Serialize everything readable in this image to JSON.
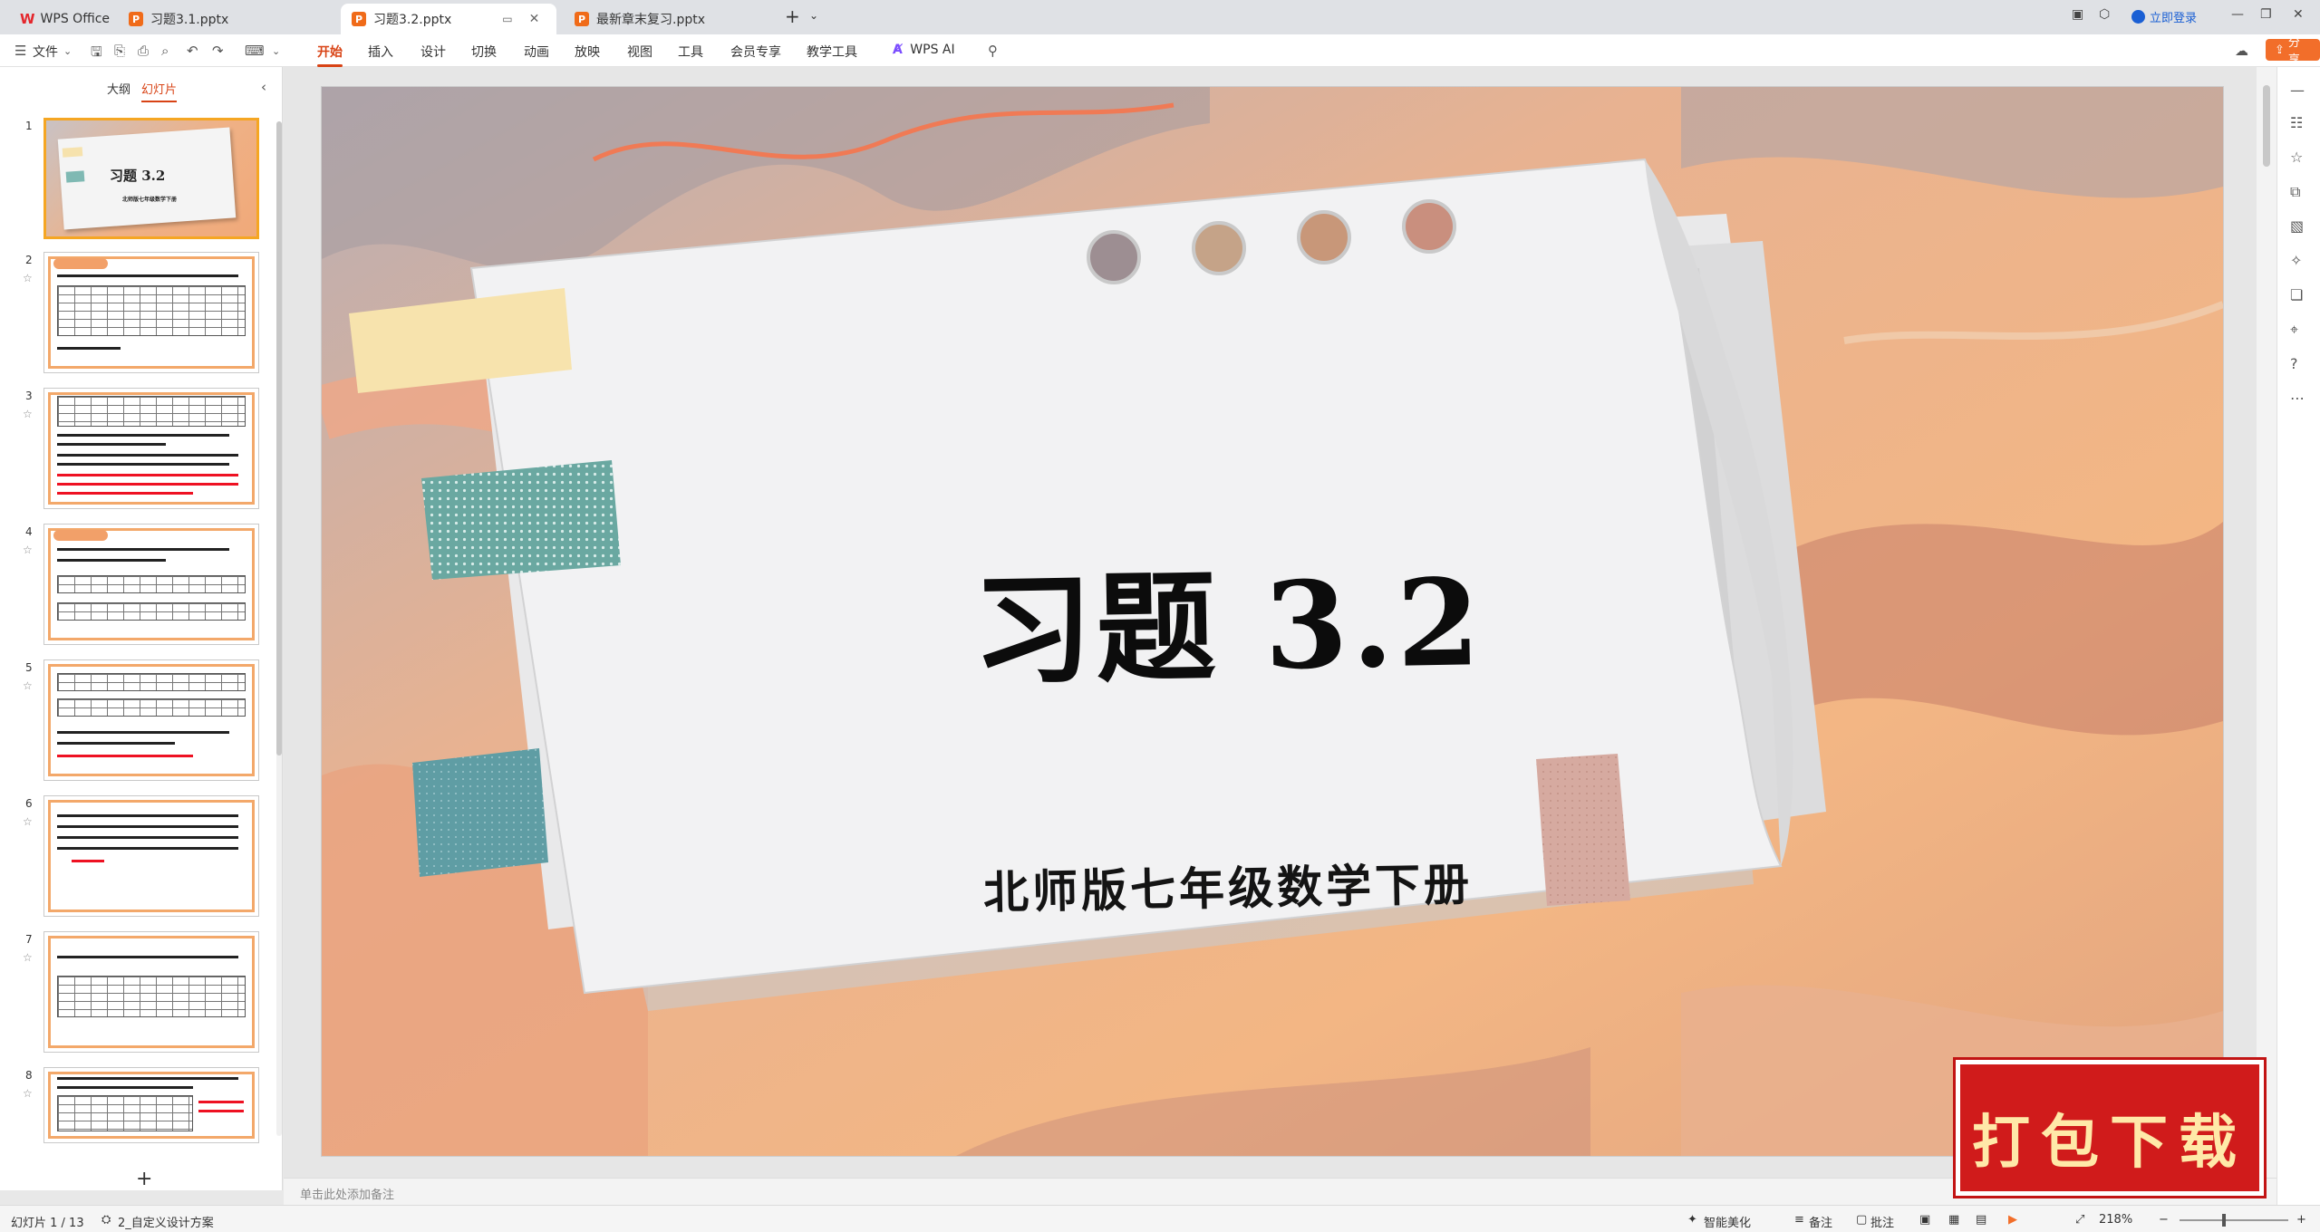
{
  "titlebar": {
    "tabs": [
      {
        "label": "WPS Office",
        "icon": "wps-logo-icon"
      },
      {
        "label": "习题3.1.pptx",
        "icon": "ppt-file-icon"
      },
      {
        "label": "习题3.2.pptx",
        "icon": "ppt-file-icon",
        "active": true
      },
      {
        "label": "最新章末复习.pptx",
        "icon": "ppt-file-icon"
      }
    ],
    "add_tab": "+",
    "login_label": "立即登录"
  },
  "ribbon": {
    "file_menu": "文件",
    "tabs": [
      "开始",
      "插入",
      "设计",
      "切换",
      "动画",
      "放映",
      "视图",
      "工具",
      "会员专享",
      "教学工具"
    ],
    "active_tab": "开始",
    "wps_ai": "WPS AI",
    "share_label": "分享"
  },
  "left_panel": {
    "tabs": [
      "大纲",
      "幻灯片"
    ],
    "active_tab": "幻灯片",
    "slides": [
      {
        "num": "1",
        "title": "习题 3.2",
        "subtitle": "北师版七年级数学下册"
      },
      {
        "num": "2"
      },
      {
        "num": "3"
      },
      {
        "num": "4"
      },
      {
        "num": "5"
      },
      {
        "num": "6"
      },
      {
        "num": "7"
      },
      {
        "num": "8"
      }
    ],
    "add_slide": "+"
  },
  "slide": {
    "title": "习题 3.2",
    "subtitle": "北师版七年级数学下册"
  },
  "notes_placeholder": "单击此处添加备注",
  "download_badge": "打包下载",
  "statusbar": {
    "slide_counter": "幻灯片 1 / 13",
    "theme": "2_自定义设计方案",
    "smart_beautify": "智能美化",
    "notes": "备注",
    "comments": "批注",
    "zoom": "218%"
  },
  "colors": {
    "accent": "#d84315",
    "share": "#f26e2a",
    "slide_bg": "#f1b887",
    "badge": "#d01b1b"
  }
}
